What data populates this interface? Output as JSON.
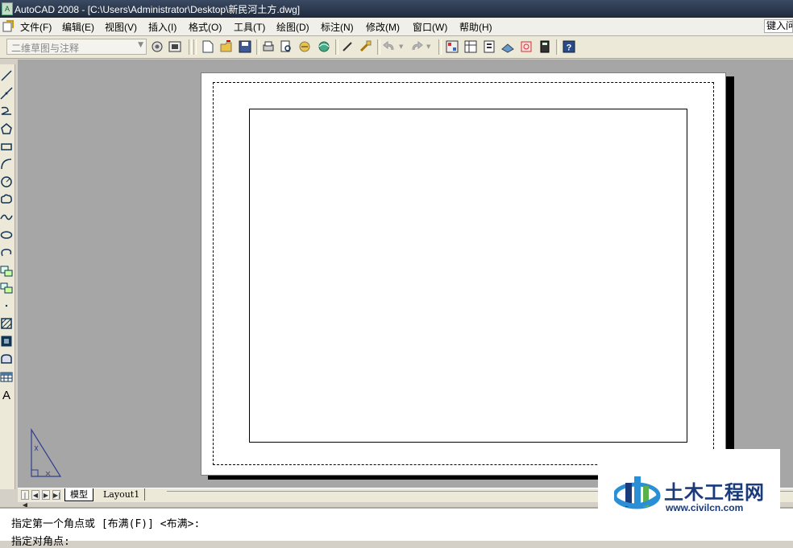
{
  "window": {
    "title": "AutoCAD 2008 - [C:\\Users\\Administrator\\Desktop\\新民河土方.dwg]"
  },
  "menubar": {
    "items": [
      "文件(F)",
      "编辑(E)",
      "视图(V)",
      "插入(I)",
      "格式(O)",
      "工具(T)",
      "绘图(D)",
      "标注(N)",
      "修改(M)",
      "窗口(W)",
      "帮助(H)"
    ],
    "search_text": "键入问"
  },
  "toolbar": {
    "workspace_value": "二维草图与注释"
  },
  "tabs": {
    "model": "模型",
    "layout1": "Layout1"
  },
  "command": {
    "line1": "指定第一个角点或 [布满(F)] <布满>:",
    "line2": "指定对角点:"
  },
  "watermark": {
    "name": "土木工程网",
    "url": "www.civilcn.com"
  },
  "colors": {
    "canvas_bg": "#a6a6a6",
    "paper": "#ffffff",
    "titlebar": "#2b3950",
    "watermark_blue": "#1a3a7a"
  }
}
